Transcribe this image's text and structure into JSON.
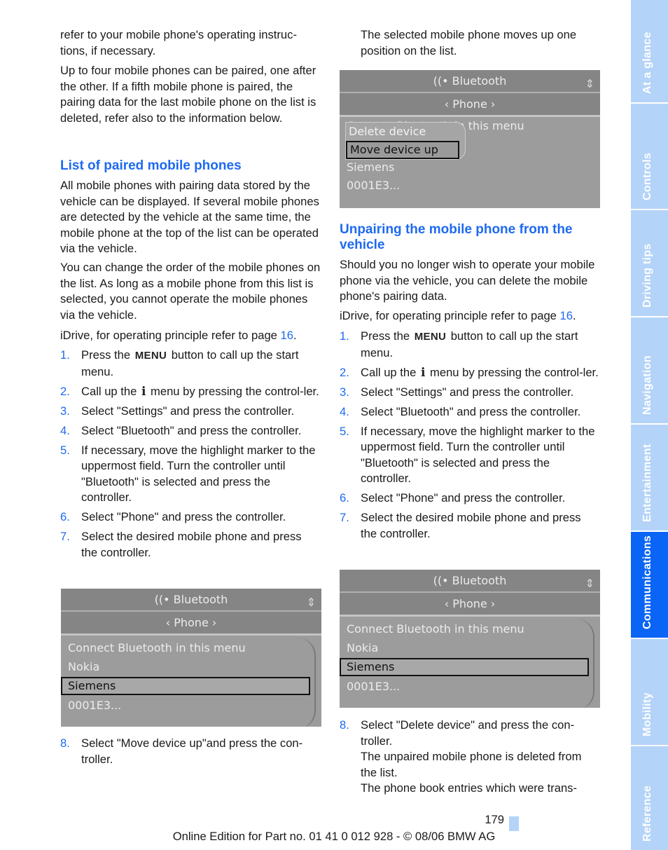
{
  "left": {
    "p1": "refer to your mobile phone's operating instruc-tions, if necessary.",
    "p2": "Up to four mobile phones can be paired, one after the other. If a fifth mobile phone is paired, the pairing data for the last mobile phone on the list is deleted, refer also to the information below.",
    "heading": "List of paired mobile phones",
    "p3": "All mobile phones with pairing data stored by the vehicle can be displayed. If several mobile phones are detected by the vehicle at the same time, the mobile phone at the top of the list can be operated via the vehicle.",
    "p4": "You can change the order of the mobile phones on the list. As long as a mobile phone from this list is selected, you cannot operate the mobile phones via the vehicle.",
    "idrive_text": "iDrive, for operating principle refer to page ",
    "idrive_page": "16",
    "idrive_end": ".",
    "steps": [
      {
        "n": "1.",
        "a": "Press the ",
        "icon": "MENU",
        "b": " button to call up the start menu."
      },
      {
        "n": "2.",
        "a": "Call up the ",
        "icon": "i",
        "b": " menu by pressing the control-ler."
      },
      {
        "n": "3.",
        "a": "Select \"Settings\" and press the controller."
      },
      {
        "n": "4.",
        "a": "Select \"Bluetooth\" and press the controller."
      },
      {
        "n": "5.",
        "a": "If necessary, move the highlight marker to the uppermost field. Turn the controller until \"Bluetooth\" is selected and press the controller."
      },
      {
        "n": "6.",
        "a": "Select \"Phone\" and press the controller."
      },
      {
        "n": "7.",
        "a": "Select the desired mobile phone and press the controller."
      }
    ],
    "screen": {
      "title": "((• Bluetooth",
      "sub": "‹ Phone ›",
      "items": [
        "Connect Bluetooth in this menu",
        "Nokia",
        "Siemens",
        "0001E3..."
      ],
      "selected": "Siemens"
    },
    "step8": {
      "n": "8.",
      "a": "Select \"Move device up\"and press the con-troller."
    }
  },
  "right": {
    "p1": "The selected mobile phone moves up one position on the list.",
    "screen1": {
      "title": "((• Bluetooth",
      "sub": "‹ Phone ›",
      "behind": "Connect Bluetooth in this menu",
      "items": [
        "Siemens",
        "0001E3..."
      ],
      "popup": [
        "Delete device",
        "Move device up"
      ],
      "popup_selected": "Move device up"
    },
    "heading": "Unpairing the mobile phone from the vehicle",
    "p2": "Should you no longer wish to operate your mobile phone via the vehicle, you can delete the mobile phone's pairing data.",
    "idrive_text": "iDrive, for operating principle refer to page ",
    "idrive_page": "16",
    "idrive_end": ".",
    "steps": [
      {
        "n": "1.",
        "a": "Press the ",
        "icon": "MENU",
        "b": " button to call up the start menu."
      },
      {
        "n": "2.",
        "a": "Call up the ",
        "icon": "i",
        "b": " menu by pressing the control-ler."
      },
      {
        "n": "3.",
        "a": "Select \"Settings\" and press the controller."
      },
      {
        "n": "4.",
        "a": "Select \"Bluetooth\" and press the controller."
      },
      {
        "n": "5.",
        "a": "If necessary, move the highlight marker to the uppermost field. Turn the controller until \"Bluetooth\" is selected and press the controller."
      },
      {
        "n": "6.",
        "a": "Select \"Phone\" and press the controller."
      },
      {
        "n": "7.",
        "a": "Select the desired mobile phone and press the controller."
      }
    ],
    "screen2": {
      "title": "((• Bluetooth",
      "sub": "‹ Phone ›",
      "items": [
        "Connect Bluetooth in this menu",
        "Nokia",
        "Siemens",
        "0001E3..."
      ],
      "selected": "Siemens"
    },
    "step8": {
      "n": "8.",
      "a": "Select \"Delete device\" and press the con-troller.",
      "c1": "The unpaired mobile phone is deleted from the list.",
      "c2": "The phone book entries which were trans-"
    }
  },
  "tabs": [
    {
      "label": "At a glance",
      "active": false
    },
    {
      "label": "Controls",
      "active": false
    },
    {
      "label": "Driving tips",
      "active": false
    },
    {
      "label": "Navigation",
      "active": false
    },
    {
      "label": "Entertainment",
      "active": false
    },
    {
      "label": "Communications",
      "active": true
    },
    {
      "label": "Mobility",
      "active": false
    },
    {
      "label": "Reference",
      "active": false
    }
  ],
  "colors": {
    "accent": "#1e6af0",
    "tab": "#b4d3f8",
    "tab_active": "#0a64f5"
  },
  "footer": {
    "page": "179",
    "text": "Online Edition for Part no. 01 41 0 012 928 - © 08/06 BMW AG"
  }
}
